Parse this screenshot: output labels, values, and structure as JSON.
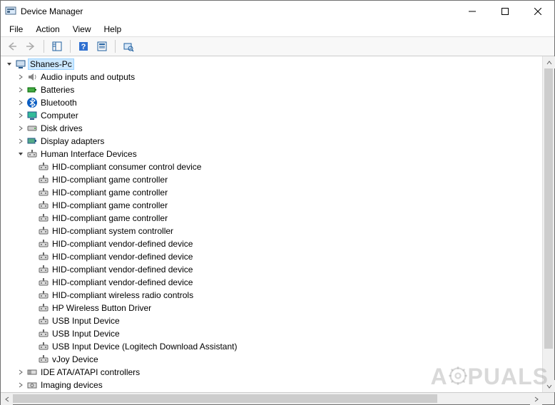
{
  "window": {
    "title": "Device Manager"
  },
  "menu": {
    "file": "File",
    "action": "Action",
    "view": "View",
    "help": "Help"
  },
  "tree": {
    "root": "Shanes-Pc",
    "categories": {
      "audio": "Audio inputs and outputs",
      "batteries": "Batteries",
      "bluetooth": "Bluetooth",
      "computer": "Computer",
      "disk": "Disk drives",
      "display": "Display adapters",
      "hid": "Human Interface Devices",
      "ide": "IDE ATA/ATAPI controllers",
      "imaging": "Imaging devices"
    },
    "hid_children": [
      "HID-compliant consumer control device",
      "HID-compliant game controller",
      "HID-compliant game controller",
      "HID-compliant game controller",
      "HID-compliant game controller",
      "HID-compliant system controller",
      "HID-compliant vendor-defined device",
      "HID-compliant vendor-defined device",
      "HID-compliant vendor-defined device",
      "HID-compliant vendor-defined device",
      "HID-compliant wireless radio controls",
      "HP Wireless Button Driver",
      "USB Input Device",
      "USB Input Device",
      "USB Input Device (Logitech Download Assistant)",
      "vJoy Device"
    ]
  },
  "watermark": "A  PUALS"
}
